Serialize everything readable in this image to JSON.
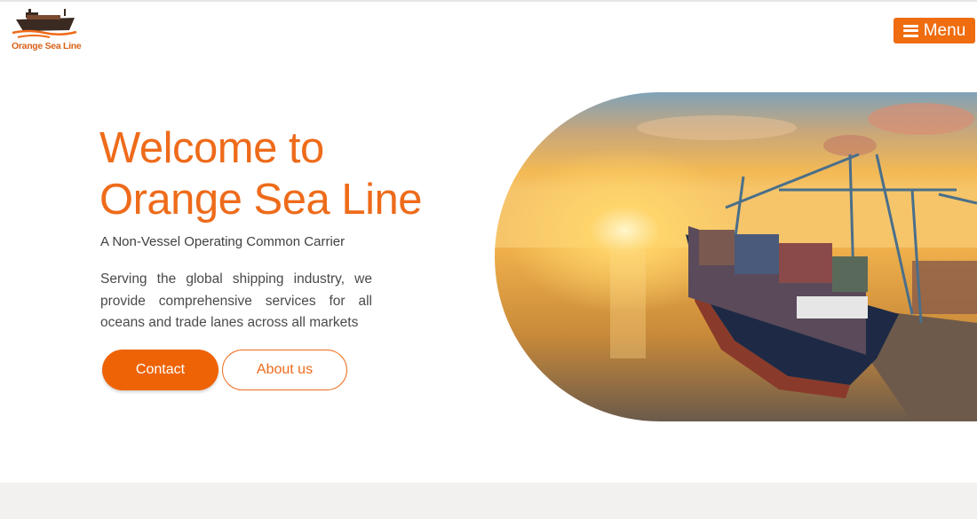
{
  "brand": {
    "logo_text": "Orange Sea Line",
    "logo_icon": "ship-icon",
    "accent_color": "#ee6b1a"
  },
  "nav": {
    "menu_label": "Menu",
    "menu_icon": "hamburger-icon"
  },
  "hero": {
    "title_line1": "Welcome to",
    "title_line2": "Orange Sea Line",
    "subtitle": "A Non-Vessel Operating Common Carrier",
    "description": "Serving the global shipping industry, we provide comprehensive services for all oceans and trade lanes across all markets",
    "contact_label": "Contact",
    "about_label": "About us",
    "image_icon": "container-ship-sunset-photo"
  }
}
